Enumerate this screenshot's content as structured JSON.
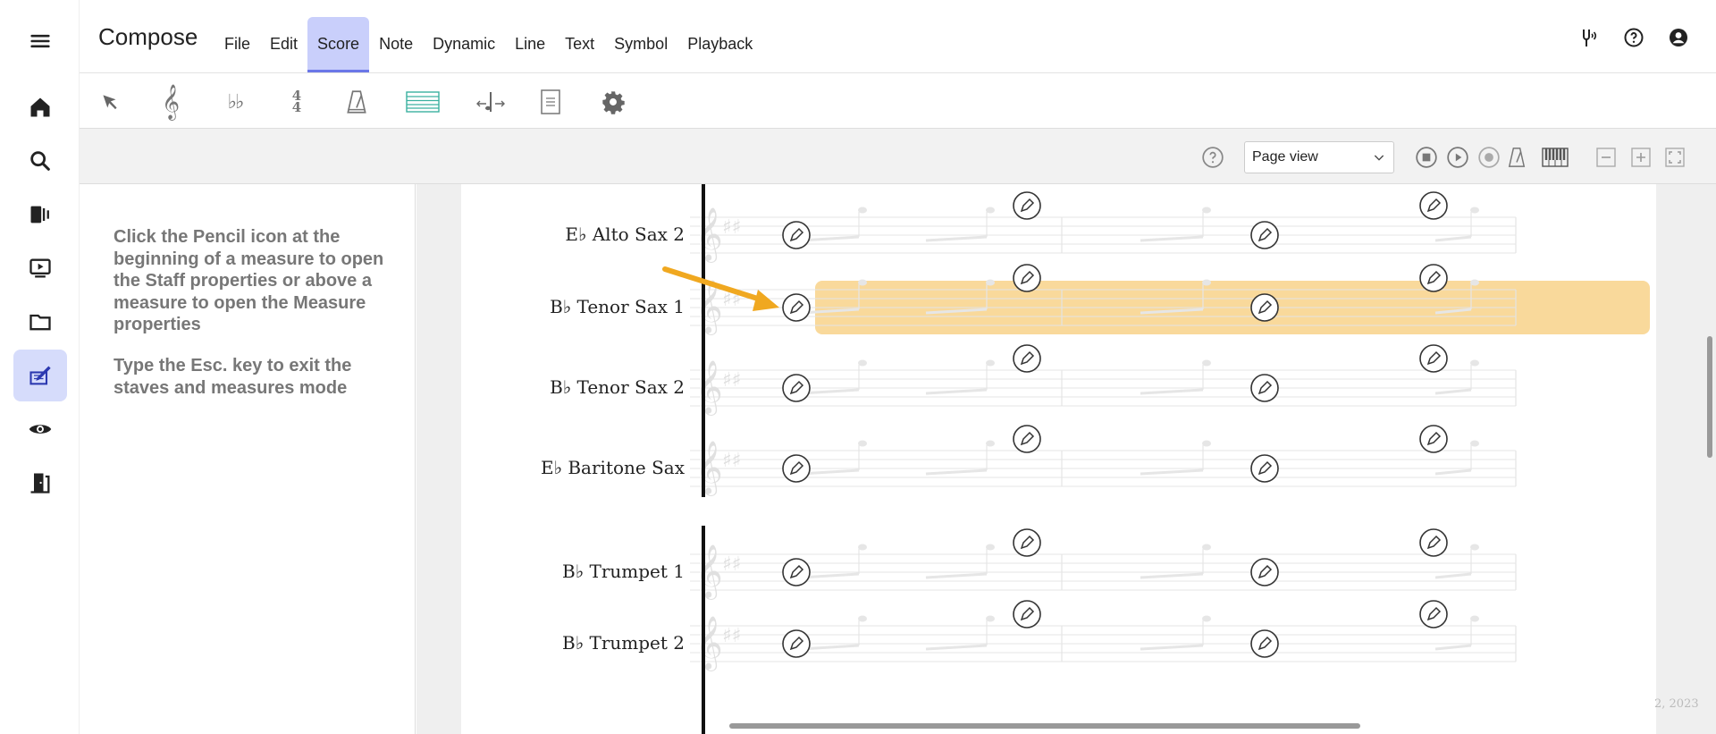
{
  "app": {
    "title": "Compose",
    "menu": [
      "File",
      "Edit",
      "Score",
      "Note",
      "Dynamic",
      "Line",
      "Text",
      "Symbol",
      "Playback"
    ],
    "active_menu": "Score"
  },
  "controls": {
    "view_select": "Page view"
  },
  "help": {
    "paragraph1": "Click the Pencil icon at the beginning of a measure to open the Staff properties or above a measure to open the Measure properties",
    "paragraph2": "Type the Esc. key to exit the staves and measures mode"
  },
  "score": {
    "staves": [
      "E♭ Alto Sax 2",
      "B♭ Tenor Sax 1",
      "B♭ Tenor Sax 2",
      "E♭ Baritone Sax",
      "B♭ Trumpet 1",
      "B♭ Trumpet 2"
    ],
    "highlighted_staff": "B♭ Tenor Sax 1",
    "copyright": "2, 2023"
  },
  "colors": {
    "accent": "#c9cffb",
    "highlight": "#f8d590",
    "arrow": "#f0a820"
  }
}
